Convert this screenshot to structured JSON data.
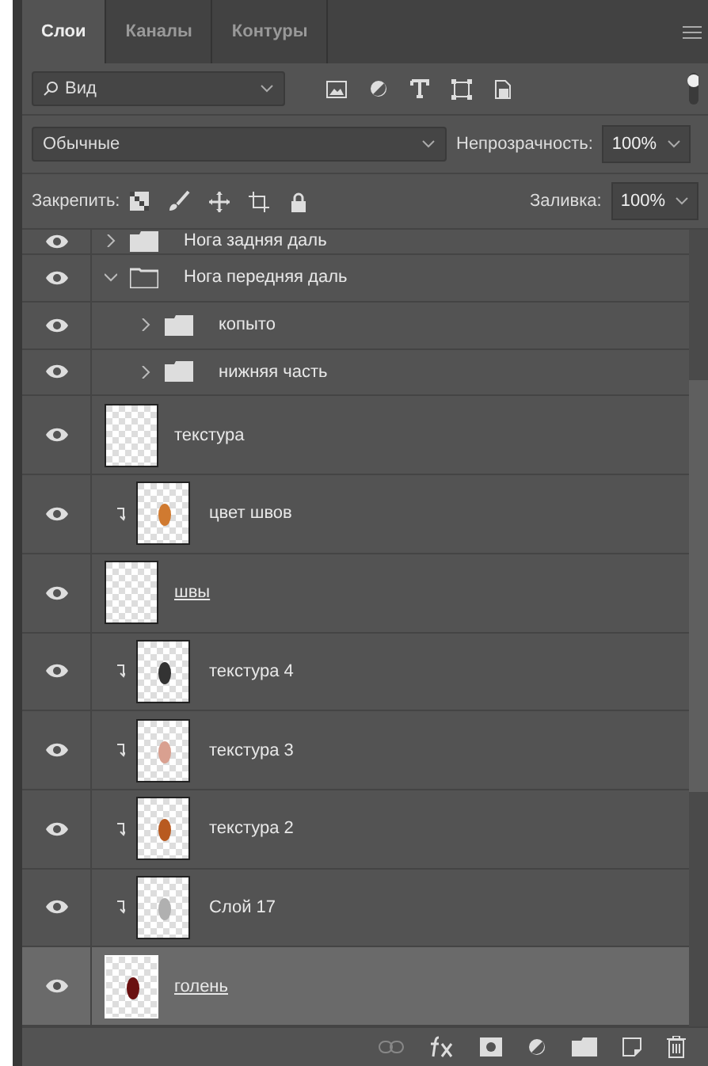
{
  "tabs": [
    {
      "label": "Слои",
      "selected": true
    },
    {
      "label": "Каналы",
      "selected": false
    },
    {
      "label": "Контуры",
      "selected": false
    }
  ],
  "filter": {
    "value": "Вид",
    "on": true
  },
  "blend": {
    "value": "Обычные",
    "opacity_label": "Непрозрачность:",
    "opacity": "100%"
  },
  "lock": {
    "label": "Закрепить:",
    "fill_label": "Заливка:",
    "fill": "100%"
  },
  "layers": [
    {
      "kind": "group",
      "name": "Нога задняя даль",
      "visible": true,
      "expanded": false,
      "selected": false,
      "cut": true
    },
    {
      "kind": "group",
      "name": "Нога передняя даль",
      "visible": true,
      "expanded": true,
      "selected": false,
      "children": [
        {
          "kind": "group",
          "name": "копыто",
          "visible": true,
          "expanded": false,
          "selected": false
        },
        {
          "kind": "group",
          "name": "нижняя часть",
          "visible": true,
          "expanded": false,
          "selected": false
        },
        {
          "kind": "layer",
          "name": "текстура",
          "visible": true,
          "clipped": false,
          "underlined": false,
          "selected": false
        },
        {
          "kind": "layer",
          "name": "цвет швов",
          "visible": true,
          "clipped": true,
          "underlined": false,
          "selected": false,
          "color": "#d07a30"
        },
        {
          "kind": "layer",
          "name": "швы",
          "visible": true,
          "clipped": false,
          "underlined": true,
          "selected": false
        },
        {
          "kind": "layer",
          "name": "текстура 4",
          "visible": true,
          "clipped": true,
          "underlined": false,
          "selected": false,
          "color": "#333333"
        },
        {
          "kind": "layer",
          "name": "текстура 3",
          "visible": true,
          "clipped": true,
          "underlined": false,
          "selected": false,
          "color": "#d9a090"
        },
        {
          "kind": "layer",
          "name": "текстура 2",
          "visible": true,
          "clipped": true,
          "underlined": false,
          "selected": false,
          "color": "#b85a20"
        },
        {
          "kind": "layer",
          "name": "Слой 17",
          "visible": true,
          "clipped": true,
          "underlined": false,
          "selected": false,
          "color": "#b0b0b0"
        },
        {
          "kind": "layer",
          "name": "голень",
          "visible": true,
          "clipped": false,
          "underlined": true,
          "selected": true,
          "color": "#6a1010"
        }
      ]
    }
  ]
}
